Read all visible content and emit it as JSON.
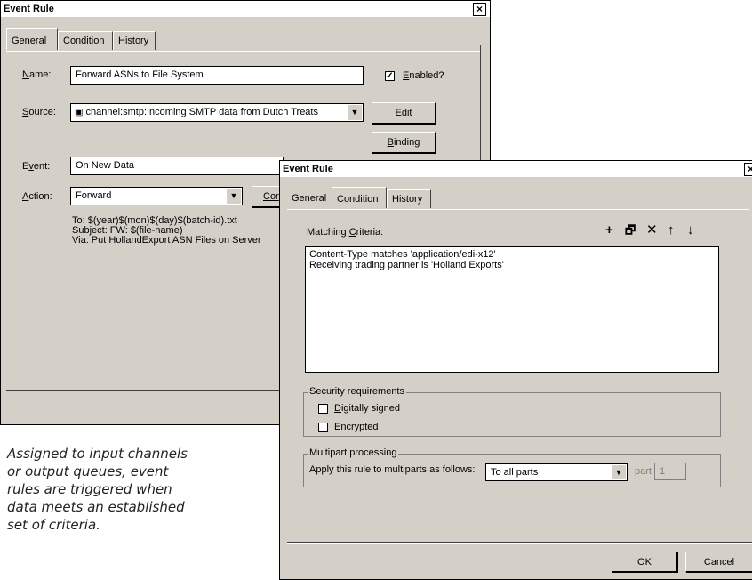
{
  "back_dialog": {
    "title": "Event Rule",
    "tabs": [
      "General",
      "Condition",
      "History"
    ],
    "name_label": "Name:",
    "name_value": "Forward ASNs to File System",
    "enabled_label": "Enabled?",
    "enabled_checked": true,
    "source_label": "Source:",
    "source_value": "channel:smtp:Incoming SMTP data from Dutch Treats",
    "edit_label": "Edit",
    "binding_label": "Binding",
    "event_label": "Event:",
    "event_value": "On New Data",
    "action_label": "Action:",
    "action_value": "Forward",
    "configure_label": "Cor",
    "details": [
      "To: $(year)$(mon)$(day)$(batch-id).txt",
      "Subject: FW: $(file-name)",
      "Via: Put HollandExport ASN Files on Server"
    ]
  },
  "front_dialog": {
    "title": "Event Rule",
    "tabs": [
      "General",
      "Condition",
      "History"
    ],
    "matching_label": "Matching Criteria:",
    "criteria": [
      "Content-Type matches 'application/edi-x12'",
      "Receiving trading partner is 'Holland Exports'"
    ],
    "toolbar_icons": [
      "plus-icon",
      "properties-icon",
      "delete-icon",
      "up-arrow-icon",
      "down-arrow-icon"
    ],
    "security_title": "Security requirements",
    "digitally_signed_label": "Digitally signed",
    "encrypted_label": "Encrypted",
    "multipart_title": "Multipart processing",
    "multipart_label": "Apply this rule to multiparts as follows:",
    "multipart_value": "To all parts",
    "part_label": "part",
    "part_value": "1",
    "ok_label": "OK",
    "cancel_label": "Cancel"
  },
  "caption": [
    "Assigned to input channels",
    "or output queues, event",
    "rules are triggered when",
    "data meets an established",
    "set of criteria."
  ]
}
